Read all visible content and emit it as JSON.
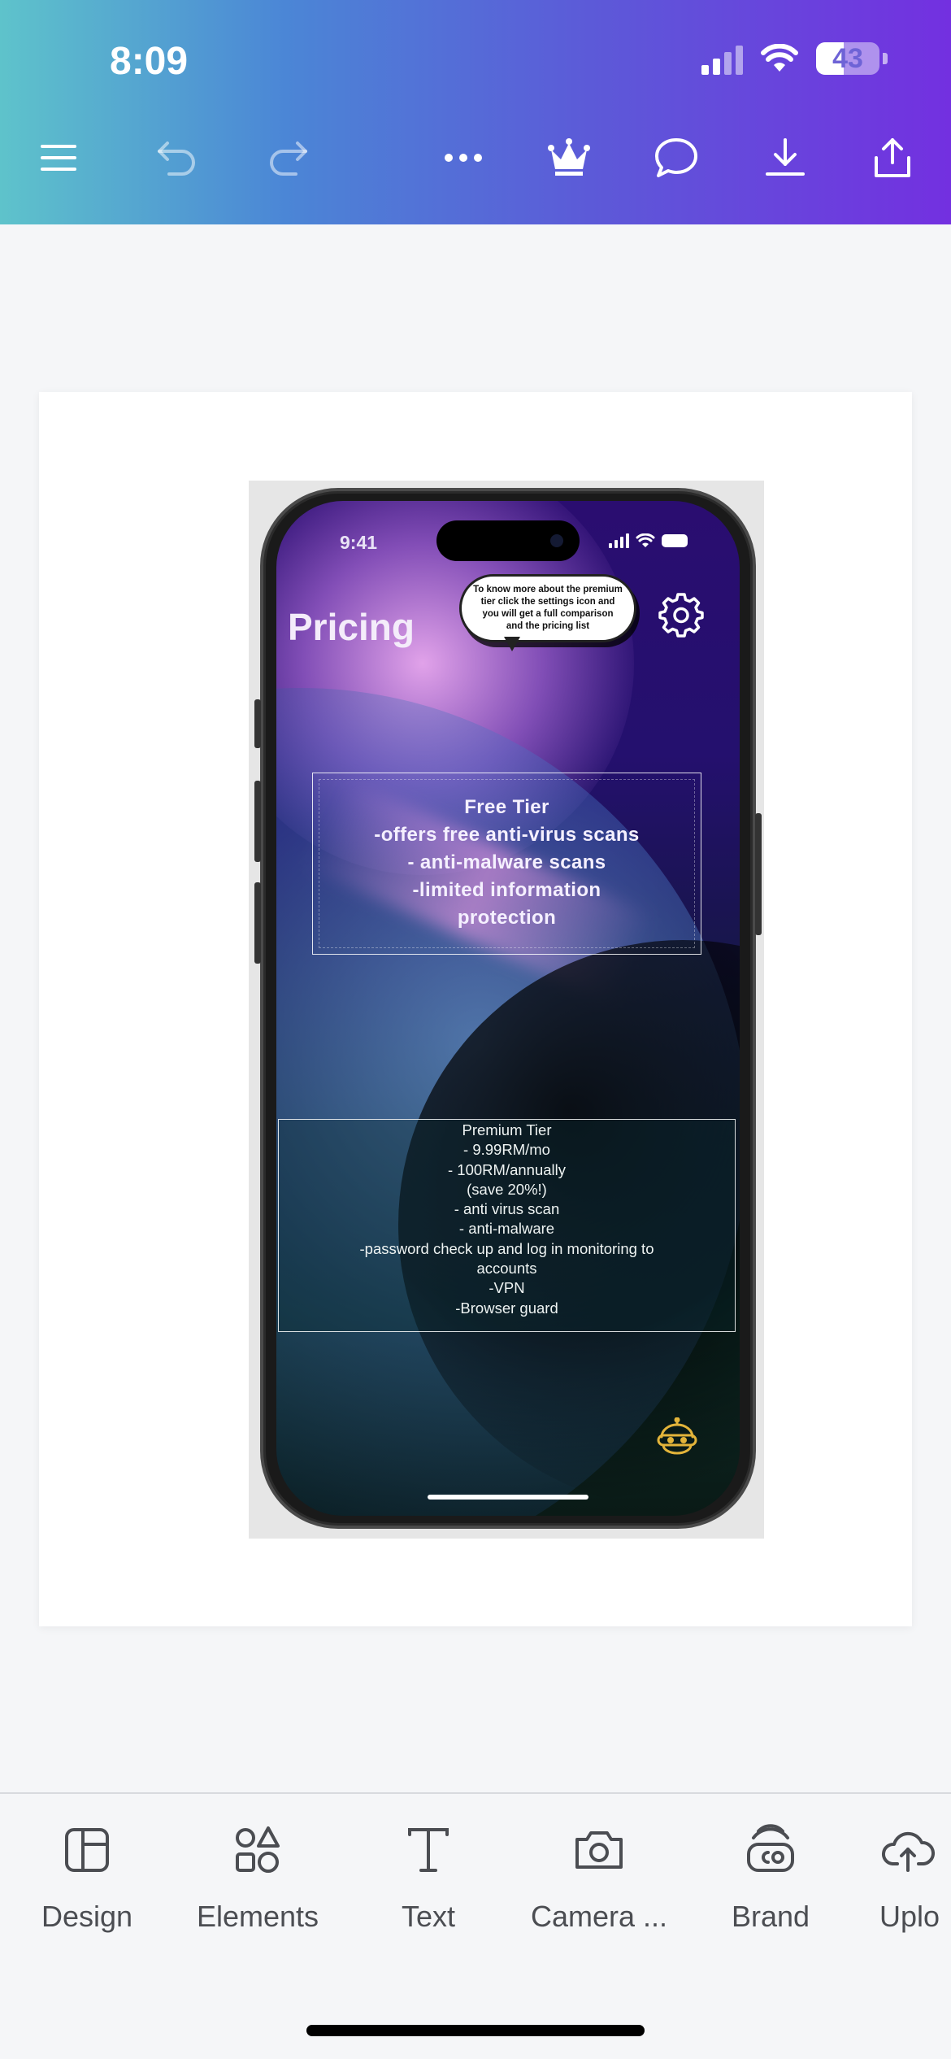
{
  "status_bar": {
    "time": "8:09",
    "battery": "43",
    "battery_level_percent": 43
  },
  "toolbar": {
    "icons": [
      "menu-icon",
      "undo-icon",
      "redo-icon",
      "more-icon",
      "crown-icon",
      "comment-icon",
      "download-icon",
      "share-icon"
    ]
  },
  "design": {
    "phone_status_time": "9:41",
    "title": "Pricing",
    "tooltip": "To know more about the premium tier click the settings icon and you will get a full comparison and the pricing list",
    "free_tier": {
      "lines": [
        "Free Tier",
        "-offers free anti-virus scans",
        "- anti-malware scans",
        "-limited information",
        "protection"
      ]
    },
    "premium_tier": {
      "lines": [
        "Premium Tier",
        "- 9.99RM/mo",
        "- 100RM/annually",
        "(save 20%!)",
        "- anti virus scan",
        "- anti-malware",
        "-password check up and log in monitoring to",
        "accounts",
        "-VPN",
        "-Browser guard"
      ]
    }
  },
  "bottom_nav": {
    "items": [
      {
        "label": "Design",
        "icon": "layout-icon"
      },
      {
        "label": "Elements",
        "icon": "shapes-icon"
      },
      {
        "label": "Text",
        "icon": "text-icon"
      },
      {
        "label": "Camera ...",
        "icon": "camera-icon"
      },
      {
        "label": "Brand",
        "icon": "brand-icon"
      },
      {
        "label": "Uplo",
        "icon": "upload-icon"
      }
    ]
  },
  "colors": {
    "gradient_start": "#5ec3cb",
    "gradient_end": "#7330e0",
    "robot_icon": "#e3b43a"
  }
}
